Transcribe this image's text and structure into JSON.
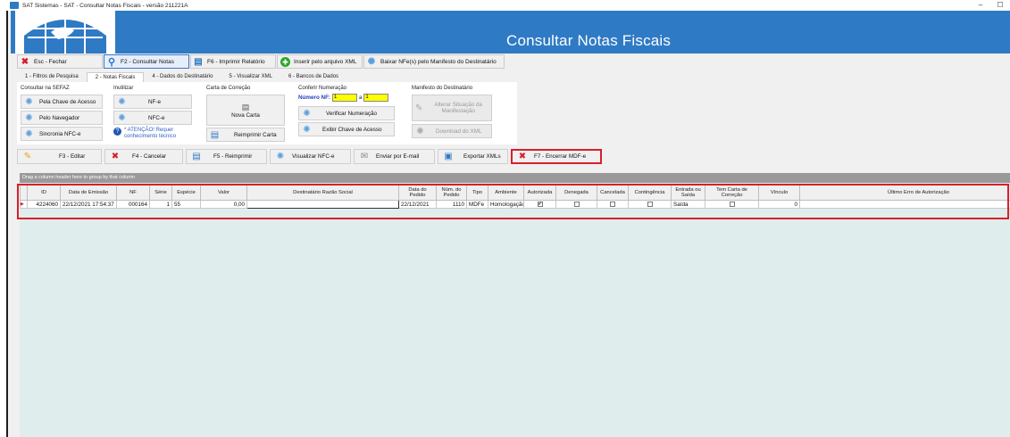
{
  "window": {
    "title": "SAT Sistemas - SAT - Consultar Notas Fiscais - versão 211221A",
    "minimize_glyph": "–",
    "maximize_glyph": "☐"
  },
  "banner": {
    "title": "Consultar Notas Fiscais",
    "color": "#2f7ac4"
  },
  "toolbar": {
    "close": "Esc - Fechar",
    "consult": "F2 - Consultar Notas",
    "print_report": "F6 - Imprimir Relatório",
    "import_xml": "Inserir pelo arquivo XML",
    "download_nfe": "Baixar NFe(s) pelo Manifesto do Destinatário"
  },
  "tabs": [
    "1 - Filtros de Pesquisa",
    "2 - Notas Fiscais",
    "4 - Dados do Destinatário",
    "5 - Visualizar XML",
    "6 - Bancos de Dados"
  ],
  "groups": {
    "consultar": {
      "label": "Consultar na SEFAZ",
      "btn1": "Pela Chave de Acesso",
      "btn2": "Pelo Navegador",
      "btn3": "Sincronia NFC-e"
    },
    "inutilizar": {
      "label": "Inutilizar",
      "btn1": "NF-e",
      "btn2": "NFC-e",
      "attention": "* ATENÇÃO! Requer conhecimento técnico"
    },
    "carta": {
      "label": "Carta de Correção",
      "btn1": "Nova Carta",
      "btn2": "Reimprimir Carta"
    },
    "numeracao": {
      "label": "Conferir Numeração",
      "numero_label": "Número NF:",
      "from": "1",
      "to_label": "a",
      "to": "1",
      "btn1": "Verificar Numeração",
      "btn2": "Exibir Chave de Acesso"
    },
    "manifesto": {
      "label": "Manifesto do Destinatário",
      "btn1": "Alterar Situação da Manifestação",
      "btn2": "Download do XML"
    }
  },
  "actions": {
    "edit": "F3 - Editar",
    "cancel": "F4 - Cancelar",
    "reprint": "F5 - Reimprimir",
    "view_nfce": "Visualizar NFC-e",
    "email": "Enviar por E-mail",
    "export": "Exportar XMLs",
    "close_mdfe": "F7 - Encerrar MDF-e"
  },
  "grid": {
    "group_hint": "Drag a column header here to group by that column",
    "columns": [
      "ID",
      "Data de Emissão",
      "NF",
      "Série",
      "Espécie",
      "Valor",
      "Destinatário Razão Social",
      "Data do Pedido",
      "Núm. do Pedido",
      "Tipo",
      "Ambiente",
      "Autorizada",
      "Denegada",
      "Cancelada",
      "Contingência",
      "Entrada ou Saída",
      "Tem Carta de Correção",
      "Vínculo",
      "Último Erro de Autorização"
    ],
    "rows": [
      {
        "id": "4224060",
        "emissao": "22/12/2021 17:54:37",
        "nf": "000164",
        "serie": "1",
        "especie": "55",
        "valor": "0,00",
        "destinatario": "",
        "data_pedido": "22/12/2021",
        "num_pedido": "1110",
        "tipo": "MDFe",
        "ambiente": "Homologação",
        "autorizada": "✔",
        "denegada": "",
        "cancelada": "",
        "contingencia": "",
        "entrada_saida": "Saída",
        "carta": "",
        "vinculo": "0",
        "ultimo_erro": ""
      }
    ]
  }
}
